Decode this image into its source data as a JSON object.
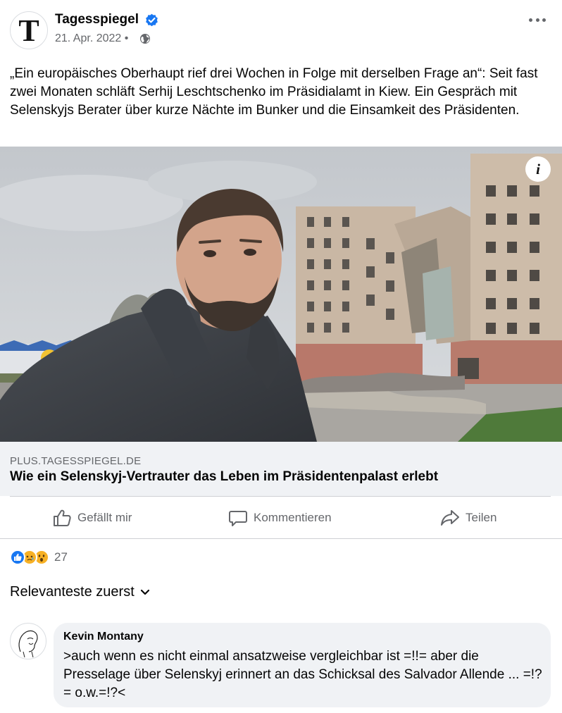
{
  "post": {
    "page_name": "Tagesspiegel",
    "avatar_letter": "T",
    "date": "21. Apr. 2022 •",
    "privacy_icon": "globe-icon",
    "verified_icon": "verified-badge-icon",
    "more_icon": "more-options-icon",
    "text": "„Ein europäisches Oberhaupt rief drei Wochen in Folge mit derselben Frage an“: Seit fast zwei Monaten schläft Serhij Leschtschenko im Präsidialamt in Kiew. Ein Gespräch mit Selenskyjs Berater über kurze Nächte im Bunker und die Einsamkeit des Präsidenten."
  },
  "link": {
    "info_label": "i",
    "domain": "PLUS.TAGESSPIEGEL.DE",
    "title": "Wie ein Selenskyj-Vertrauter das Leben im Präsidentenpalast erlebt"
  },
  "actions": {
    "like": "Gefällt mir",
    "comment": "Kommentieren",
    "share": "Teilen"
  },
  "reactions": {
    "icons": [
      "like-reaction-icon",
      "sad-reaction-icon",
      "wow-reaction-icon"
    ],
    "count": "27"
  },
  "comments_sort": {
    "label": "Relevanteste zuerst"
  },
  "comments": [
    {
      "author": "Kevin Montany",
      "text": ">auch wenn es nicht einmal ansatzweise vergleichbar ist =!!= aber die Presselage über Selenskyj  erinnert an das Schicksal des  Salvador Allende ... =!?=  o.w.=!?<"
    }
  ],
  "colors": {
    "brand_blue": "#1877f2",
    "secondary_text": "#65676b",
    "link_meta_bg": "#f0f2f5"
  }
}
